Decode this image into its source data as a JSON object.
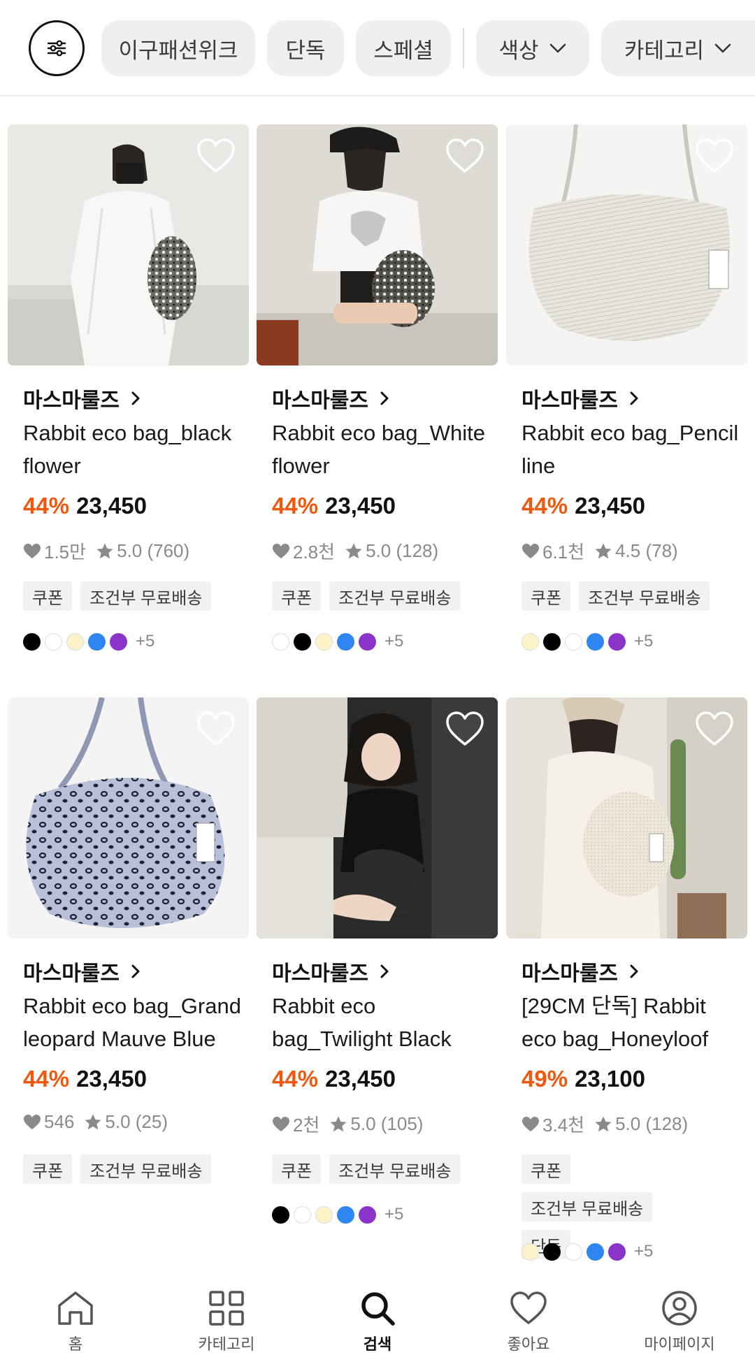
{
  "filters": {
    "chips": [
      {
        "label": "이구패션위크"
      },
      {
        "label": "단독"
      },
      {
        "label": "스페셜"
      }
    ],
    "dropdowns": [
      {
        "label": "색상"
      },
      {
        "label": "카테고리"
      }
    ]
  },
  "products": [
    {
      "brand": "마스마룰즈",
      "name": "Rabbit eco bag_black flower",
      "discount": "44%",
      "price": "23,450",
      "likes": "1.5만",
      "rating": "5.0 (760)",
      "tags": [
        "쿠폰",
        "조건부 무료배송"
      ],
      "swatches": [
        "#000000",
        "#ffffff",
        "#fdf3c9",
        "#2f86f0",
        "#8a34c9"
      ],
      "more_colors": "+5"
    },
    {
      "brand": "마스마룰즈",
      "name": "Rabbit eco bag_White flower",
      "discount": "44%",
      "price": "23,450",
      "likes": "2.8천",
      "rating": "5.0 (128)",
      "tags": [
        "쿠폰",
        "조건부 무료배송"
      ],
      "swatches": [
        "#ffffff",
        "#000000",
        "#fdf3c9",
        "#2f86f0",
        "#8a34c9"
      ],
      "more_colors": "+5"
    },
    {
      "brand": "마스마룰즈",
      "name": "Rabbit eco bag_Pencil line",
      "discount": "44%",
      "price": "23,450",
      "likes": "6.1천",
      "rating": "4.5 (78)",
      "tags": [
        "쿠폰",
        "조건부 무료배송"
      ],
      "swatches": [
        "#fdf3c9",
        "#000000",
        "#ffffff",
        "#2f86f0",
        "#8a34c9"
      ],
      "more_colors": "+5"
    },
    {
      "brand": "마스마룰즈",
      "name": "Rabbit eco bag_Grand leopard Mauve Blue",
      "discount": "44%",
      "price": "23,450",
      "likes": "546",
      "rating": "5.0 (25)",
      "tags": [
        "쿠폰",
        "조건부 무료배송"
      ],
      "swatches": [],
      "more_colors": ""
    },
    {
      "brand": "마스마룰즈",
      "name": "Rabbit eco bag_Twilight Black",
      "discount": "44%",
      "price": "23,450",
      "likes": "2천",
      "rating": "5.0 (105)",
      "tags": [
        "쿠폰",
        "조건부 무료배송"
      ],
      "swatches": [
        "#000000",
        "#ffffff",
        "#fdf3c9",
        "#2f86f0",
        "#8a34c9"
      ],
      "more_colors": "+5"
    },
    {
      "brand": "마스마룰즈",
      "name": "[29CM 단독] Rabbit eco bag_Honeyloof",
      "discount": "49%",
      "price": "23,100",
      "likes": "3.4천",
      "rating": "5.0 (128)",
      "tags": [
        "쿠폰",
        "조건부 무료배송",
        "단독"
      ],
      "swatches": [
        "#fdf3c9",
        "#000000",
        "#ffffff",
        "#2f86f0",
        "#8a34c9"
      ],
      "more_colors": "+5"
    }
  ],
  "nav": {
    "items": [
      {
        "label": "홈",
        "icon": "home-icon"
      },
      {
        "label": "카테고리",
        "icon": "grid-icon"
      },
      {
        "label": "검색",
        "icon": "search-icon"
      },
      {
        "label": "좋아요",
        "icon": "heart-icon"
      },
      {
        "label": "마이페이지",
        "icon": "user-icon"
      }
    ],
    "active": "검색"
  },
  "colors": {
    "discount": "#f0580e",
    "chip_bg": "#efefef",
    "tag_bg": "#f1f1f1"
  }
}
